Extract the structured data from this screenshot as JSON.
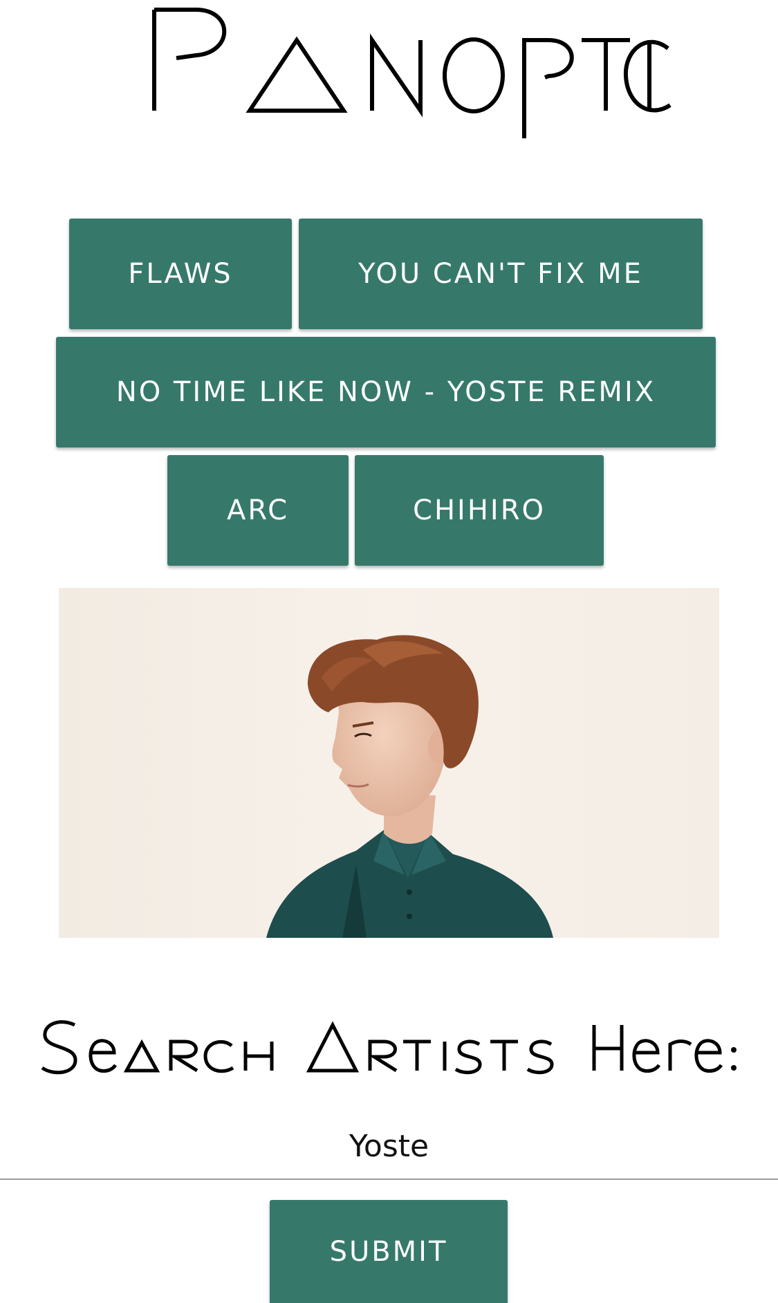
{
  "brand": {
    "logo_text": "Panoptic"
  },
  "tracks": [
    {
      "label": "FLAWS"
    },
    {
      "label": "YOU CAN'T FIX ME"
    },
    {
      "label": "NO TIME LIKE NOW - YOSTE REMIX"
    },
    {
      "label": "ARC"
    },
    {
      "label": "CHIHIRO"
    }
  ],
  "artist_image": {
    "alt": "artist-photo"
  },
  "search": {
    "heading": "Search Artists Here:",
    "value": "Yoste",
    "submit_label": "SUBMIT"
  },
  "colors": {
    "accent": "#36796b",
    "background": "#ffffff",
    "text": "#111111"
  }
}
